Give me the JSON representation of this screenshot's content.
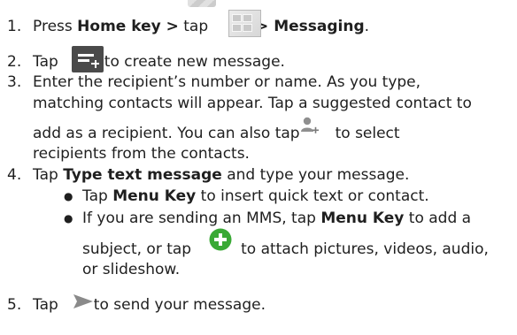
{
  "steps": [
    {
      "number": "1.",
      "segments": [
        {
          "text": "Press "
        },
        {
          "text": "Home key >",
          "bold": true
        },
        {
          "text": " tap"
        },
        {
          "text": " > Messaging",
          "bold": true
        },
        {
          "text": "."
        }
      ]
    },
    {
      "number": "2.",
      "segments": [
        {
          "text": "Tap"
        },
        {
          "text": "to create new message."
        }
      ]
    },
    {
      "number": "3.",
      "lines": [
        "Enter the recipient’s number or name. As you type,",
        "matching contacts will appear. Tap a suggested contact to",
        "add as a recipient. You can also tap",
        "to select",
        "recipients from the contacts."
      ]
    },
    {
      "number": "4.",
      "segments": [
        {
          "text": "Tap "
        },
        {
          "text": "Type text message",
          "bold": true
        },
        {
          "text": " and type your message."
        }
      ],
      "bullets": [
        {
          "segments": [
            {
              "text": "Tap "
            },
            {
              "text": "Menu Key",
              "bold": true
            },
            {
              "text": " to insert quick text or contact."
            }
          ]
        },
        {
          "line1": [
            {
              "text": "If you are sending an MMS, tap "
            },
            {
              "text": "Menu Key",
              "bold": true
            },
            {
              "text": " to add a"
            }
          ],
          "line2_before": "subject, or tap",
          "line2_after": "to attach pictures, videos, audio,",
          "line3": "or slideshow."
        }
      ]
    },
    {
      "number": "5.",
      "segments": [
        {
          "text": "Tap"
        },
        {
          "text": "to send your message."
        }
      ]
    }
  ],
  "icons": {
    "launcher": "apps-launcher-icon",
    "compose": "compose-message-icon",
    "add_contact": "add-contact-icon",
    "attach": "green-plus-attach-icon",
    "send": "send-arrow-icon"
  },
  "colors": {
    "text": "#1f1f1f",
    "compose_bg": "#4a4a4a",
    "attach_green": "#39a935",
    "send_gray": "#8a8a8a"
  }
}
